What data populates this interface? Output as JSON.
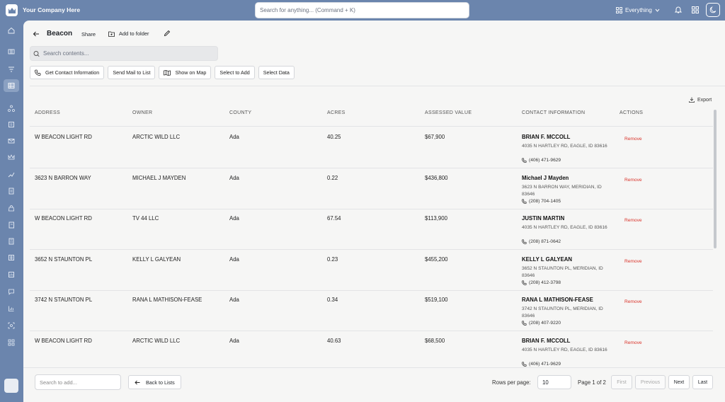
{
  "topbar": {
    "company": "Your Company Here",
    "search_placeholder": "Search for anything... (Command + K)",
    "scope": "Everything"
  },
  "header": {
    "title": "Beacon",
    "share": "Share",
    "add_to_folder": "Add to folder"
  },
  "content_search": {
    "placeholder": "Search contents..."
  },
  "actions": {
    "contact": "Get Contact Information",
    "mail": "Send Mail to List",
    "map": "Show on Map",
    "select_add": "Select to Add",
    "select_data": "Select Data"
  },
  "export": "Export",
  "table": {
    "columns": [
      "ADDRESS",
      "OWNER",
      "COUNTY",
      "ACRES",
      "ASSESSED VALUE",
      "CONTACT INFORMATION",
      "ACTIONS"
    ],
    "remove_label": "Remove",
    "rows": [
      {
        "address": "W BEACON LIGHT RD",
        "owner": "ARCTIC WILD LLC",
        "county": "Ada",
        "acres": "40.25",
        "value": "$67,900",
        "contact_name": "BRIAN F. MCCOLL",
        "contact_addr": "4035 N HARTLEY RD, EAGLE, ID 83616",
        "phone": "(406) 471-9629"
      },
      {
        "address": "3623 N BARRON WAY",
        "owner": "MICHAEL J MAYDEN",
        "county": "Ada",
        "acres": "0.22",
        "value": "$436,800",
        "contact_name": "Michael J Mayden",
        "contact_addr": "3623 N BARRON WAY, MERIDIAN, ID 83646",
        "phone": "(208) 704-1405"
      },
      {
        "address": "W BEACON LIGHT RD",
        "owner": "TV 44 LLC",
        "county": "Ada",
        "acres": "67.54",
        "value": "$113,900",
        "contact_name": "JUSTIN MARTIN",
        "contact_addr": "4035 N HARTLEY RD, EAGLE, ID 83616",
        "phone": "(208) 871-0642"
      },
      {
        "address": "3652 N STAUNTON PL",
        "owner": "KELLY L GALYEAN",
        "county": "Ada",
        "acres": "0.23",
        "value": "$455,200",
        "contact_name": "KELLY L GALYEAN",
        "contact_addr": "3652 N STAUNTON PL, MERIDIAN, ID 83646",
        "phone": "(208) 412-3798"
      },
      {
        "address": "3742 N STAUNTON PL",
        "owner": "RANA L MATHISON-FEASE",
        "county": "Ada",
        "acres": "0.34",
        "value": "$519,100",
        "contact_name": "RANA L MATHISON-FEASE",
        "contact_addr": "3742 N STAUNTON PL, MERIDIAN, ID 83646",
        "phone": "(208) 407-9220"
      },
      {
        "address": "W BEACON LIGHT RD",
        "owner": "ARCTIC WILD LLC",
        "county": "Ada",
        "acres": "40.63",
        "value": "$68,500",
        "contact_name": "BRIAN F. MCCOLL",
        "contact_addr": "4035 N HARTLEY RD, EAGLE, ID 83616",
        "phone": "(406) 471-9629"
      }
    ]
  },
  "footer": {
    "add_placeholder": "Search to add...",
    "back": "Back to Lists",
    "rows_per_page_label": "Rows per page:",
    "rows_per_page": "10",
    "page_of": "Page 1 of 2",
    "first": "First",
    "previous": "Previous",
    "next": "Next",
    "last": "Last"
  },
  "colors": {
    "brand": "#6b85ad",
    "remove": "#d9342b",
    "panel": "#f6f6f5"
  }
}
